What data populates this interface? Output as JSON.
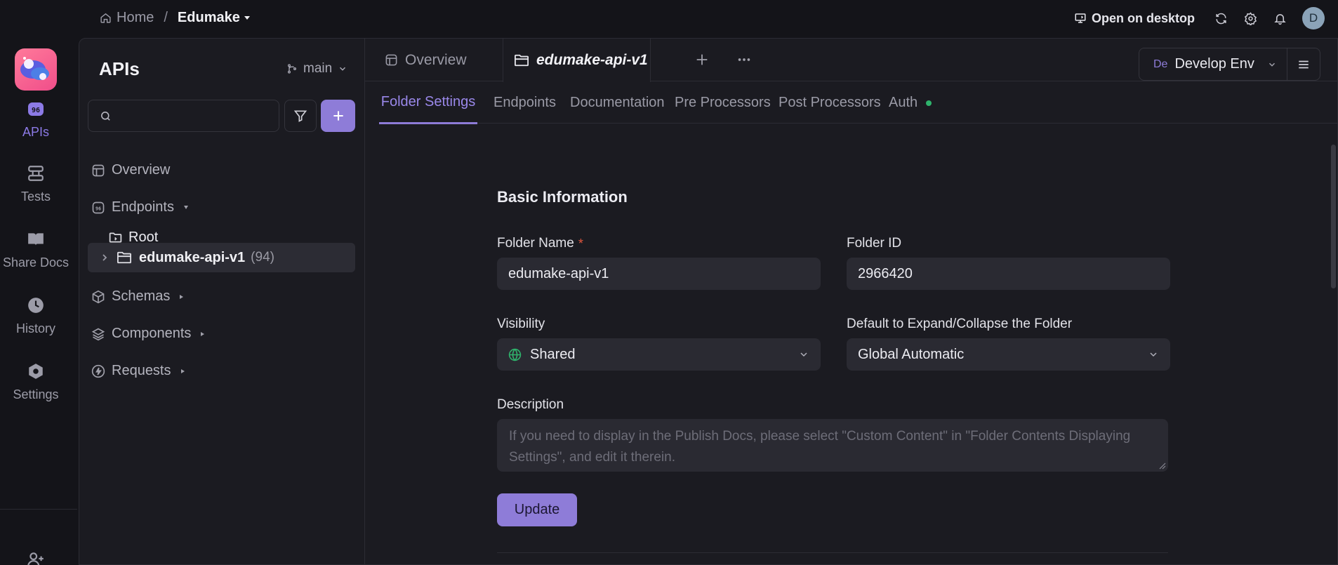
{
  "breadcrumb": {
    "home_label": "Home",
    "separator": "/",
    "project_label": "Edumake"
  },
  "topbar": {
    "open_desktop_label": "Open on desktop",
    "avatar_initial": "D"
  },
  "rail": {
    "items": [
      {
        "label": "APIs",
        "icon": "api-icon",
        "active": true
      },
      {
        "label": "Tests",
        "icon": "tests-icon"
      },
      {
        "label": "Share Docs",
        "icon": "book-icon"
      },
      {
        "label": "History",
        "icon": "clock-icon"
      },
      {
        "label": "Settings",
        "icon": "gear-hex-icon"
      }
    ]
  },
  "sidebar": {
    "title": "APIs",
    "branch": "main",
    "search_placeholder": "",
    "tree": {
      "overview": "Overview",
      "endpoints": "Endpoints",
      "root": "Root",
      "folder_name": "edumake-api-v1",
      "folder_count": "(94)",
      "schemas": "Schemas",
      "components": "Components",
      "requests": "Requests"
    }
  },
  "tabs": {
    "overview_label": "Overview",
    "active_label": "edumake-api-v1"
  },
  "environment": {
    "badge": "De",
    "label": "Develop Env"
  },
  "subtabs": {
    "items": [
      "Folder Settings",
      "Endpoints",
      "Documentation",
      "Pre Processors",
      "Post Processors",
      "Auth"
    ],
    "active_index": 0
  },
  "form": {
    "section_title": "Basic Information",
    "folder_name_label": "Folder Name",
    "required_mark": "*",
    "folder_name_value": "edumake-api-v1",
    "folder_id_label": "Folder ID",
    "folder_id_value": "2966420",
    "visibility_label": "Visibility",
    "visibility_value": "Shared",
    "expand_label": "Default to Expand/Collapse the Folder",
    "expand_value": "Global Automatic",
    "description_label": "Description",
    "description_placeholder": "If you need to display in the Publish Docs, please select \"Custom Content\" in \"Folder Contents Displaying Settings\", and edit it therein.",
    "update_label": "Update"
  },
  "colors": {
    "accent": "#8e7cd8",
    "status_green": "#2fb36c",
    "required_red": "#e0563e",
    "background": "#141419"
  }
}
